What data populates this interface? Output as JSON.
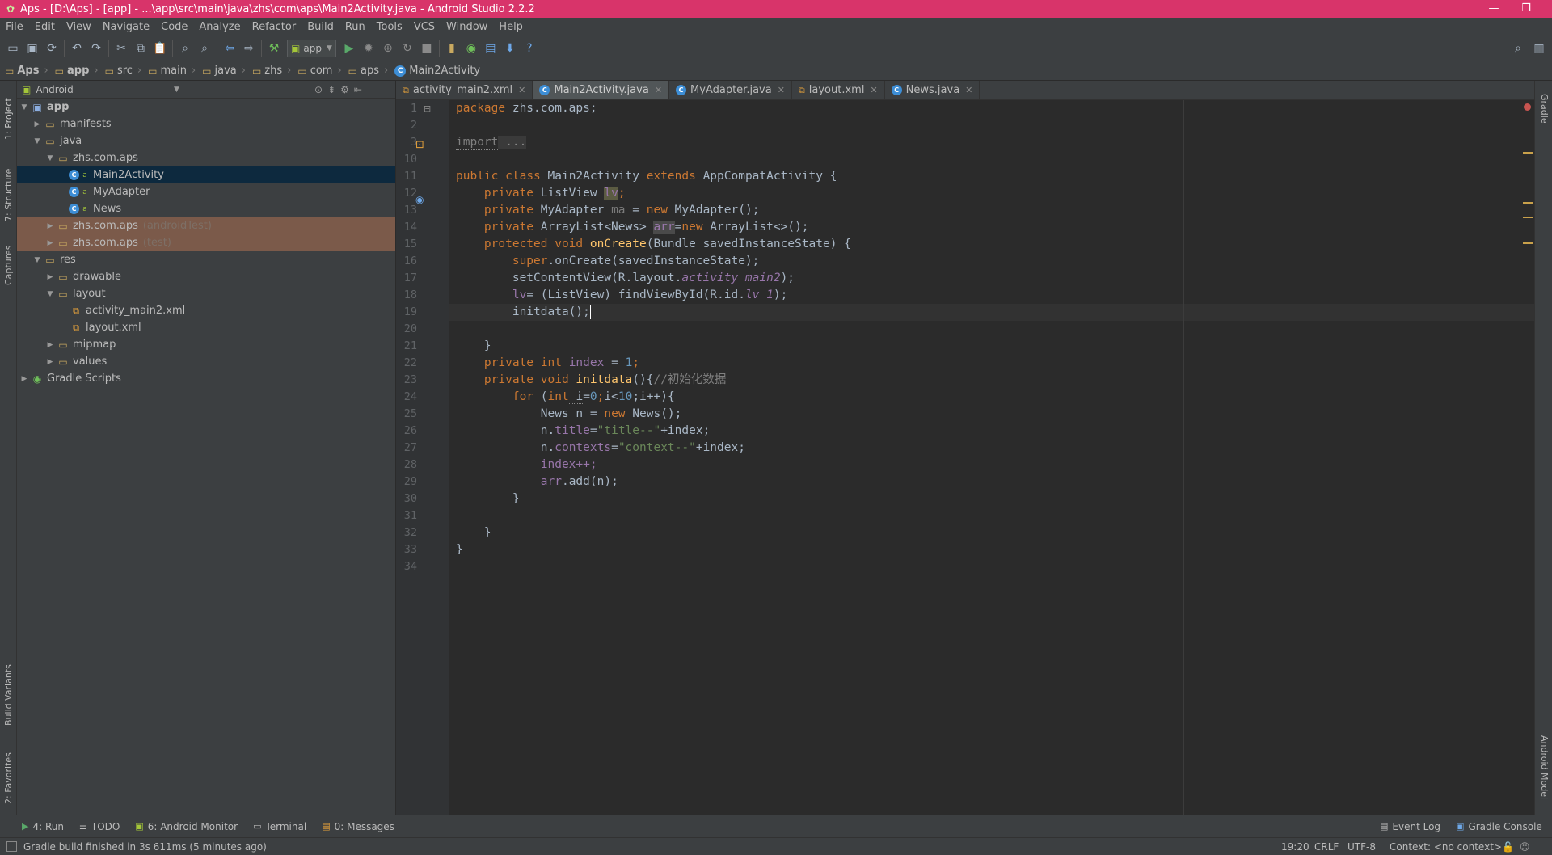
{
  "window": {
    "title": "Aps - [D:\\Aps] - [app] - ...\\app\\src\\main\\java\\zhs\\com\\aps\\Main2Activity.java - Android Studio 2.2.2",
    "minimize": "—",
    "restore": "❐",
    "close": "✕"
  },
  "menu": [
    "File",
    "Edit",
    "View",
    "Navigate",
    "Code",
    "Analyze",
    "Refactor",
    "Build",
    "Run",
    "Tools",
    "VCS",
    "Window",
    "Help"
  ],
  "toolbar": {
    "run_config": "app"
  },
  "breadcrumbs": [
    "Aps",
    "app",
    "src",
    "main",
    "java",
    "zhs",
    "com",
    "aps",
    "Main2Activity"
  ],
  "project_panel": {
    "view_selector": "Android",
    "tree": [
      {
        "label": "app",
        "icon": "app-module-icon",
        "depth": 0,
        "expanded": true,
        "bold": true
      },
      {
        "label": "manifests",
        "icon": "folder-icon",
        "depth": 1,
        "expanded": false
      },
      {
        "label": "java",
        "icon": "folder-icon",
        "depth": 1,
        "expanded": true
      },
      {
        "label": "zhs.com.aps",
        "icon": "package-icon",
        "depth": 2,
        "expanded": true
      },
      {
        "label": "Main2Activity",
        "icon": "class-icon",
        "depth": 3,
        "selected": true
      },
      {
        "label": "MyAdapter",
        "icon": "class-icon",
        "depth": 3
      },
      {
        "label": "News",
        "icon": "class-icon",
        "depth": 3
      },
      {
        "label": "zhs.com.aps",
        "suffix": "(androidTest)",
        "icon": "package-icon",
        "depth": 2,
        "expanded": false,
        "generated": true
      },
      {
        "label": "zhs.com.aps",
        "suffix": "(test)",
        "icon": "package-icon",
        "depth": 2,
        "expanded": false,
        "generated": true
      },
      {
        "label": "res",
        "icon": "folder-icon",
        "depth": 1,
        "expanded": true
      },
      {
        "label": "drawable",
        "icon": "folder-icon",
        "depth": 2,
        "expanded": false
      },
      {
        "label": "layout",
        "icon": "folder-icon",
        "depth": 2,
        "expanded": true
      },
      {
        "label": "activity_main2.xml",
        "icon": "xml-file-icon",
        "depth": 3
      },
      {
        "label": "layout.xml",
        "icon": "xml-file-icon",
        "depth": 3
      },
      {
        "label": "mipmap",
        "icon": "folder-icon",
        "depth": 2,
        "expanded": false
      },
      {
        "label": "values",
        "icon": "folder-icon",
        "depth": 2,
        "expanded": false
      },
      {
        "label": "Gradle Scripts",
        "icon": "gradle-icon",
        "depth": 0,
        "expanded": false
      }
    ]
  },
  "left_tool_tabs": [
    "1: Project",
    "7: Structure",
    "Captures",
    "Build Variants",
    "2: Favorites"
  ],
  "right_tool_tabs": [
    "Gradle",
    "Android Model"
  ],
  "editor_tabs": [
    {
      "label": "activity_main2.xml",
      "type": "xml",
      "active": false
    },
    {
      "label": "Main2Activity.java",
      "type": "class",
      "active": true
    },
    {
      "label": "MyAdapter.java",
      "type": "class",
      "active": false
    },
    {
      "label": "layout.xml",
      "type": "xml",
      "active": false
    },
    {
      "label": "News.java",
      "type": "class",
      "active": false
    }
  ],
  "code": {
    "line_numbers": [
      "1",
      "2",
      "3",
      "10",
      "11",
      "12",
      "13",
      "14",
      "15",
      "16",
      "17",
      "18",
      "19",
      "20",
      "21",
      "22",
      "23",
      "24",
      "25",
      "26",
      "27",
      "28",
      "29",
      "30",
      "31",
      "32",
      "33",
      "34"
    ],
    "t_package": "package",
    "t_pkgname": " zhs.com.aps;",
    "t_import": "import",
    "t_import_fold": " ...",
    "t_public": "public",
    "t_class": "class",
    "t_classname": " Main2Activity ",
    "t_extends": "extends",
    "t_super": " AppCompatActivity {",
    "t_private": "private",
    "t_listview": " ListView ",
    "t_lv": "lv",
    "t_semi": ";",
    "t_myadapter": " MyAdapter ",
    "t_ma": "ma",
    "t_eq": " = ",
    "t_new": "new",
    "t_myadapter_ctor": " MyAdapter();",
    "t_arraylist": " ArrayList<News> ",
    "t_arr": "arr",
    "t_eq2": "=",
    "t_arraylist_ctor": " ArrayList<>();",
    "t_protected": "protected",
    "t_void": "void",
    "t_oncreate": "onCreate",
    "t_oncreate_args": "(Bundle savedInstanceState) {",
    "t_superkw": "super",
    "t_supercall": ".onCreate(savedInstanceState);",
    "t_setcontent": "setContentView(R.layout.",
    "t_activity_main2": "activity_main2",
    "t_close_paren_semi": ");",
    "t_lv2": "lv",
    "t_cast": "= (ListView) findViewById(R.id.",
    "t_lv_1": "lv_1",
    "t_initdata_call": "initdata();",
    "t_close_brace": "}",
    "t_int": "int",
    "t_index": " index",
    "t_one": "1",
    "t_initdata": "initdata",
    "t_initdata_sig": "(){",
    "t_comment": "//初始化数据",
    "t_for": "for",
    "t_paren_open": " (",
    "t_i": " i",
    "t_zero": "0",
    "t_i2": "i",
    "t_lt": "<",
    "t_ten": "10",
    "t_forrest": ";i++){",
    "t_news_decl": "News n = ",
    "t_news_ctor": " News();",
    "t_n_title": "n.",
    "t_title": "title",
    "t_title_str": "\"title--\"",
    "t_plus_index": "+index;",
    "t_contexts": "contexts",
    "t_context_str": "\"context--\"",
    "t_indexpp": "index++;",
    "t_arr2": "arr",
    "t_add": ".add(n);"
  },
  "bottom_tools": [
    {
      "label": "4: Run",
      "icon": "run-icon"
    },
    {
      "label": "TODO",
      "icon": "todo-icon"
    },
    {
      "label": "6: Android Monitor",
      "icon": "android-icon"
    },
    {
      "label": "Terminal",
      "icon": "terminal-icon"
    },
    {
      "label": "0: Messages",
      "icon": "messages-icon"
    }
  ],
  "bottom_right_tools": [
    "Event Log",
    "Gradle Console"
  ],
  "status": {
    "message": "Gradle build finished in 3s 611ms (5 minutes ago)",
    "position": "19:20",
    "line_sep": "CRLF",
    "encoding": "UTF-8",
    "context": "Context: <no context>"
  }
}
